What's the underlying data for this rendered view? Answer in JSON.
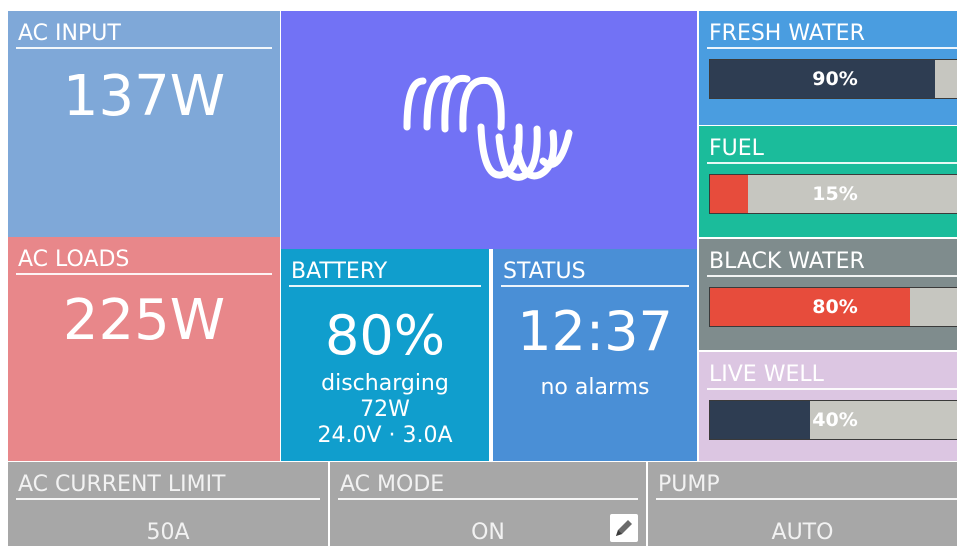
{
  "ac_input": {
    "title": "AC INPUT",
    "value": "137W",
    "color": "#7fa8d8"
  },
  "ac_loads": {
    "title": "AC LOADS",
    "value": "225W",
    "color": "#e8878a"
  },
  "logo": {
    "icon": "victron-logo-icon",
    "color": "#7272f5"
  },
  "battery": {
    "title": "BATTERY",
    "value": "80%",
    "state": "discharging",
    "power": "72W",
    "detail": "24.0V · 3.0A",
    "color": "#109ecd"
  },
  "status": {
    "title": "STATUS",
    "time": "12:37",
    "alarms": "no alarms",
    "color": "#4a8fd6"
  },
  "tanks": [
    {
      "title": "FRESH WATER",
      "percent": "90%",
      "level": 0.9,
      "tile_color": "#4a9de0",
      "fill_color": "#2e3d52"
    },
    {
      "title": "FUEL",
      "percent": "15%",
      "level": 0.15,
      "tile_color": "#1bbc9b",
      "fill_color": "#e74c3c"
    },
    {
      "title": "BLACK WATER",
      "percent": "80%",
      "level": 0.8,
      "tile_color": "#7f8c8d",
      "fill_color": "#e74c3c"
    },
    {
      "title": "LIVE WELL",
      "percent": "40%",
      "level": 0.4,
      "tile_color": "#dcc6e2",
      "fill_color": "#2e3d52"
    }
  ],
  "controls": {
    "current_limit": {
      "title": "AC CURRENT LIMIT",
      "value": "50A"
    },
    "mode": {
      "title": "AC MODE",
      "value": "ON",
      "icon": "pencil-icon"
    },
    "pump": {
      "title": "PUMP",
      "value": "AUTO"
    },
    "color": "#a7a7a7"
  }
}
